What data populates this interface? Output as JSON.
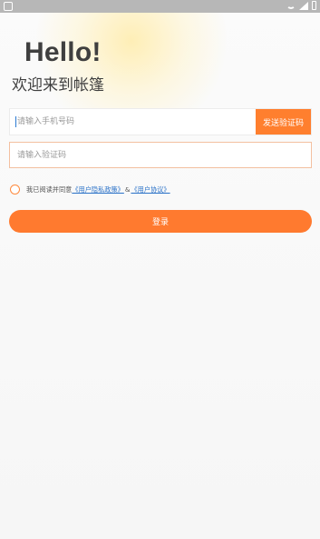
{
  "header": {
    "hello": "Hello!",
    "subtitle": "欢迎来到帐篷"
  },
  "phone": {
    "placeholder": "请输入手机号码",
    "send_code_label": "发送验证码"
  },
  "code": {
    "placeholder": "请输入验证码"
  },
  "agreement": {
    "prefix": "我已阅读并同意",
    "privacy_link": "《用户隐私政策》",
    "amp": "&",
    "user_link": "《用户协议》"
  },
  "login": {
    "label": "登录"
  },
  "colors": {
    "accent": "#ff7a2f",
    "link": "#2b72c8"
  },
  "icons": {
    "status_left": "notification-icon",
    "wifi": "wifi-icon",
    "signal": "signal-icon",
    "battery": "battery-icon"
  }
}
